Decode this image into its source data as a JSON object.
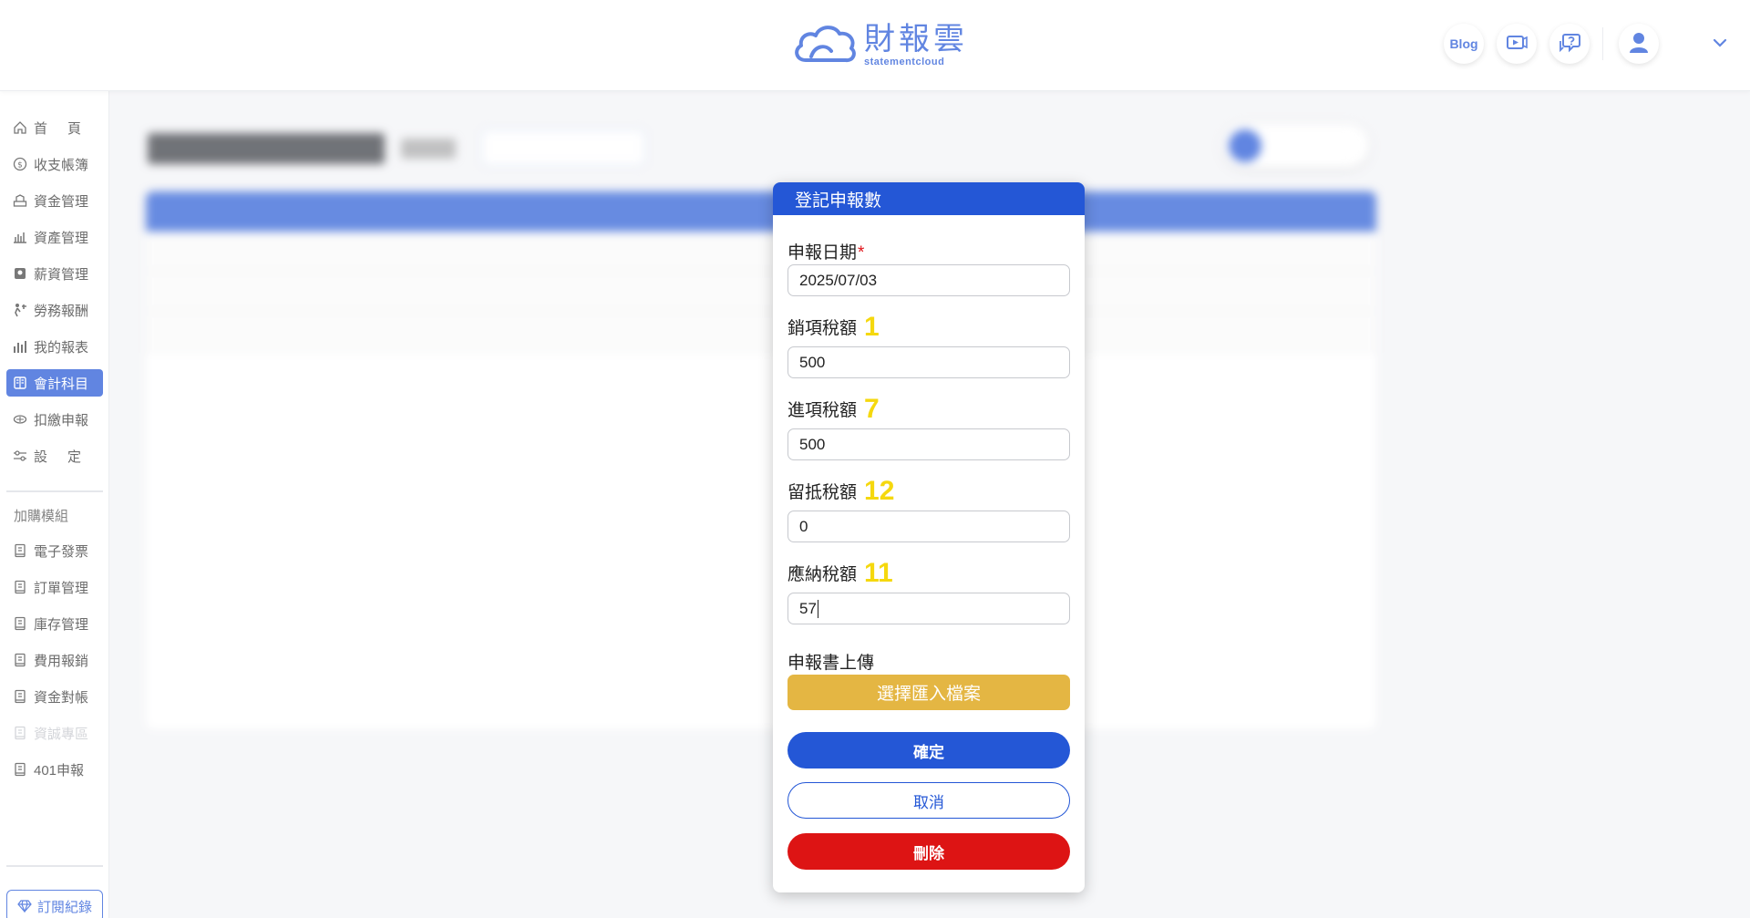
{
  "header": {
    "logo_text": "財報雲",
    "logo_subtext": "statementcloud",
    "blog_label": "Blog",
    "icons": [
      "cloud-logo-icon",
      "video-icon",
      "chat-help-icon",
      "user-icon",
      "chevron-down-icon"
    ],
    "accent_color": "#2457d6"
  },
  "sidebar": {
    "items": [
      {
        "label": "首頁",
        "icon": "home-icon"
      },
      {
        "label": "收支帳簿",
        "icon": "money-icon"
      },
      {
        "label": "資金管理",
        "icon": "fund-icon"
      },
      {
        "label": "資產管理",
        "icon": "asset-icon"
      },
      {
        "label": "薪資管理",
        "icon": "salary-icon"
      },
      {
        "label": "勞務報酬",
        "icon": "labor-icon"
      },
      {
        "label": "我的報表",
        "icon": "report-icon"
      },
      {
        "label": "會計科目",
        "icon": "ledger-icon",
        "active": true
      },
      {
        "label": "扣繳申報",
        "icon": "withholding-icon"
      },
      {
        "label": "設定",
        "icon": "settings-icon"
      }
    ],
    "addon_title": "加購模組",
    "addons": [
      {
        "label": "電子發票",
        "icon": "module-icon"
      },
      {
        "label": "訂單管理",
        "icon": "module-icon"
      },
      {
        "label": "庫存管理",
        "icon": "module-icon"
      },
      {
        "label": "費用報銷",
        "icon": "module-icon"
      },
      {
        "label": "資金對帳",
        "icon": "module-icon"
      },
      {
        "label": "資誠專區",
        "icon": "module-icon",
        "disabled": true
      },
      {
        "label": "401申報",
        "icon": "module-icon"
      }
    ],
    "subscription_label": "訂閱紀錄"
  },
  "modal": {
    "title": "登記申報數",
    "date_label": "申報日期",
    "required_mark": "*",
    "date_value": "2025/07/03",
    "fields": [
      {
        "label": "銷項稅額",
        "marker": "1",
        "value": "500"
      },
      {
        "label": "進項稅額",
        "marker": "7",
        "value": "500"
      },
      {
        "label": "留抵稅額",
        "marker": "12",
        "value": "0"
      },
      {
        "label": "應納稅額",
        "marker": "11",
        "value": "57"
      }
    ],
    "upload_label": "申報書上傳",
    "upload_button": "選擇匯入檔案",
    "confirm_button": "確定",
    "cancel_button": "取消",
    "delete_button": "刪除",
    "colors": {
      "primary": "#2457d6",
      "upload": "#e4b643",
      "danger": "#dd1414",
      "marker": "#f5d80e"
    }
  }
}
